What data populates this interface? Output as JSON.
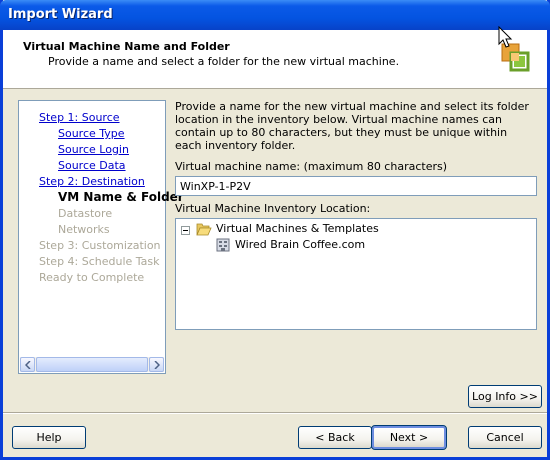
{
  "window": {
    "title": "Import Wizard"
  },
  "header": {
    "title": "Virtual Machine Name and Folder",
    "subtitle": "Provide a name and select a folder for the new virtual machine."
  },
  "steps": [
    {
      "label": "Step 1: Source",
      "state": "link"
    },
    {
      "label": "Source Type",
      "state": "link"
    },
    {
      "label": "Source Login",
      "state": "link"
    },
    {
      "label": "Source Data",
      "state": "link"
    },
    {
      "label": "Step 2: Destination",
      "state": "link"
    },
    {
      "label": "VM Name & Folder",
      "state": "current"
    },
    {
      "label": "Datastore",
      "state": "disabled"
    },
    {
      "label": "Networks",
      "state": "disabled"
    },
    {
      "label": "Step 3: Customization",
      "state": "disabled"
    },
    {
      "label": "Step 4: Schedule Task",
      "state": "disabled"
    },
    {
      "label": "Ready to Complete",
      "state": "disabled"
    }
  ],
  "main": {
    "description": "Provide a name for the new virtual machine and select its folder location in the inventory below. Virtual machine names can contain up to 80 characters, but they must be unique within each inventory folder.",
    "vm_name_label": "Virtual machine name: (maximum 80 characters)",
    "vm_name_value": "WinXP-1-P2V",
    "inventory_label": "Virtual Machine Inventory Location:",
    "tree": {
      "root": "Virtual Machines & Templates",
      "child": "Wired Brain Coffee.com"
    }
  },
  "buttons": {
    "log_info": "Log Info >>",
    "help": "Help",
    "back": "< Back",
    "next": "Next >",
    "cancel": "Cancel"
  },
  "colors": {
    "title_bar": "#0454e1",
    "link": "#0000cc",
    "disabled": "#aca899",
    "dialog_bg": "#ece9d8"
  }
}
